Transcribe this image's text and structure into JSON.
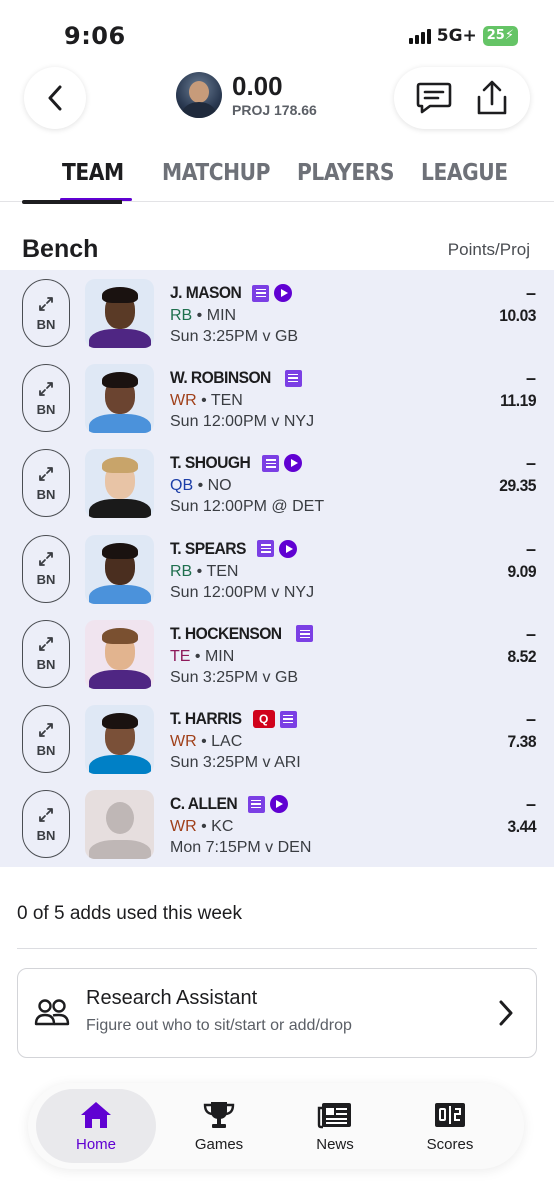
{
  "status_bar": {
    "time": "9:06",
    "network": "5G+",
    "battery": "25"
  },
  "header": {
    "score": "0.00",
    "proj": "PROJ 178.66"
  },
  "tabs": [
    "TEAM",
    "MATCHUP",
    "PLAYERS",
    "LEAGUE"
  ],
  "bench": {
    "title": "Bench",
    "column_label": "Points/Proj"
  },
  "players": [
    {
      "slot": "BN",
      "name": "J. MASON",
      "pos": "RB",
      "team": "MIN",
      "game": "Sun 3:25PM v GB",
      "points": "–",
      "proj": "10.03",
      "note": true,
      "video": true,
      "injury": ""
    },
    {
      "slot": "BN",
      "name": "W. ROBINSON",
      "pos": "WR",
      "team": "TEN",
      "game": "Sun 12:00PM v NYJ",
      "points": "–",
      "proj": "11.19",
      "note": true,
      "video": false,
      "injury": ""
    },
    {
      "slot": "BN",
      "name": "T. SHOUGH",
      "pos": "QB",
      "team": "NO",
      "game": "Sun 12:00PM @ DET",
      "points": "–",
      "proj": "29.35",
      "note": true,
      "video": true,
      "injury": ""
    },
    {
      "slot": "BN",
      "name": "T. SPEARS",
      "pos": "RB",
      "team": "TEN",
      "game": "Sun 12:00PM v NYJ",
      "points": "–",
      "proj": "9.09",
      "note": true,
      "video": true,
      "injury": ""
    },
    {
      "slot": "BN",
      "name": "T. HOCKENSON",
      "pos": "TE",
      "team": "MIN",
      "game": "Sun 3:25PM v GB",
      "points": "–",
      "proj": "8.52",
      "note": true,
      "video": false,
      "injury": ""
    },
    {
      "slot": "BN",
      "name": "T. HARRIS",
      "pos": "WR",
      "team": "LAC",
      "game": "Sun 3:25PM v ARI",
      "points": "–",
      "proj": "7.38",
      "note": true,
      "video": false,
      "injury": "Q"
    },
    {
      "slot": "BN",
      "name": "C. ALLEN",
      "pos": "WR",
      "team": "KC",
      "game": "Mon 7:15PM v DEN",
      "points": "–",
      "proj": "3.44",
      "note": true,
      "video": true,
      "injury": ""
    }
  ],
  "pos_colors": {
    "RB": "#1f6f4e",
    "WR": "#a0401a",
    "QB": "#1c3ea8",
    "TE": "#8e1a5a"
  },
  "adds": {
    "text": "0 of 5 adds used this week"
  },
  "research": {
    "title": "Research Assistant",
    "subtitle": "Figure out who to sit/start or add/drop"
  },
  "bottom_nav": [
    {
      "label": "Home",
      "icon": "home-icon",
      "active": true
    },
    {
      "label": "Games",
      "icon": "trophy-icon",
      "active": false
    },
    {
      "label": "News",
      "icon": "news-icon",
      "active": false
    },
    {
      "label": "Scores",
      "icon": "scoreboard-icon",
      "active": false
    }
  ],
  "colors": {
    "accent": "#6001d2",
    "roster_bg": "#eceef8",
    "injury": "#d0021b"
  }
}
